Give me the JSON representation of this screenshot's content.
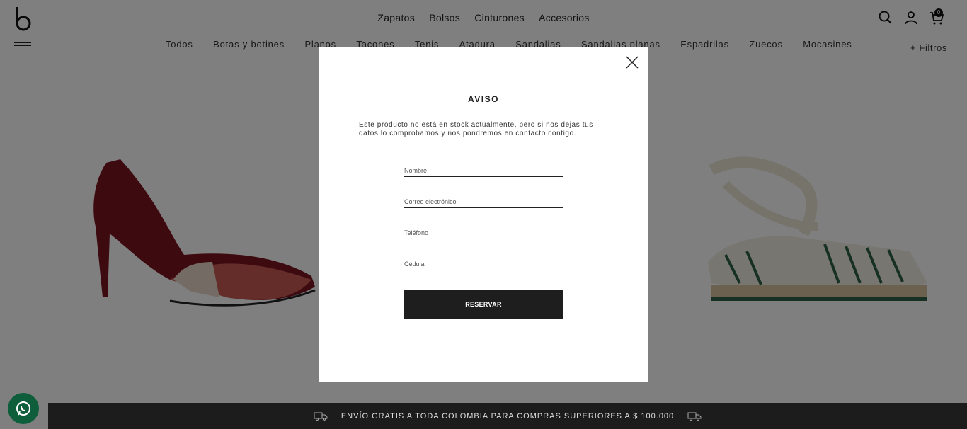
{
  "header": {
    "main_nav": [
      "Zapatos",
      "Bolsos",
      "Cinturones",
      "Accesorios"
    ],
    "active_nav": "Zapatos",
    "cart_count": "0",
    "icons": [
      "search-icon",
      "user-icon",
      "cart-icon"
    ]
  },
  "sub_nav": [
    "Todos",
    "Botas y botines",
    "Planos",
    "Tacones",
    "Tenis",
    "Atadura",
    "Sandalias",
    "Sandalias planas",
    "Espadrilas",
    "Zuecos",
    "Mocasines"
  ],
  "filters_label": "+ Filtros",
  "modal": {
    "title": "AVISO",
    "message": "Este producto no está en stock actualmente, pero si nos dejas tus datos lo comprobamos y nos pondremos en contacto contigo.",
    "fields": {
      "name_placeholder": "Nombre",
      "email_placeholder": "Correo electrónico",
      "phone_placeholder": "Teléfono",
      "id_placeholder": "Cédula"
    },
    "submit_label": "RESERVAR"
  },
  "promo_bar": {
    "text": "ENVÍO GRATIS A TODA COLOMBIA PARA COMPRAS SUPERIORES A $ 100.000"
  },
  "colors": {
    "overlay": "rgba(0,0,0,0.5)",
    "button": "#1e1e1e",
    "promo_bar": "#1c1c1c",
    "whatsapp": "#0e5e3b"
  }
}
